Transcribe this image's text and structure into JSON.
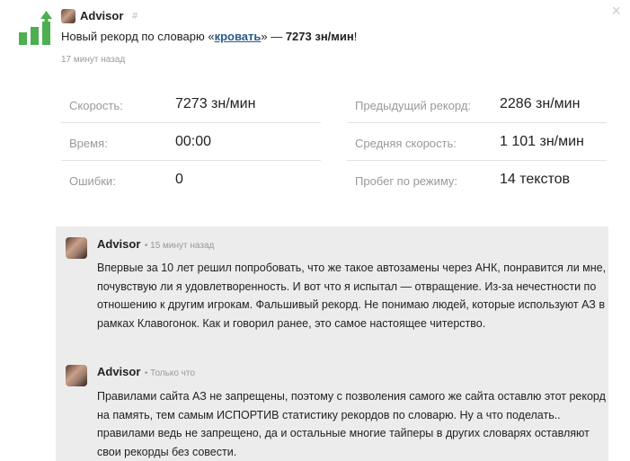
{
  "header": {
    "author": "Advisor",
    "hash": "#",
    "headline_prefix": "Новый рекорд по словарю «",
    "dictionary_link": "кровать",
    "headline_middle": "» — ",
    "headline_speed": "7273 зн/мин",
    "headline_suffix": "!",
    "time_ago": "17 минут назад",
    "close_symbol": "×"
  },
  "stats": {
    "left": [
      {
        "label": "Скорость:",
        "value": "7273 зн/мин"
      },
      {
        "label": "Время:",
        "value": "00:00"
      },
      {
        "label": "Ошибки:",
        "value": "0"
      }
    ],
    "right": [
      {
        "label": "Предыдущий рекорд:",
        "value": "2286 зн/мин"
      },
      {
        "label": "Средняя скорость:",
        "value": "1 101 зн/мин"
      },
      {
        "label": "Пробег по режиму:",
        "value": "14 текстов"
      }
    ]
  },
  "comments": [
    {
      "author": "Advisor",
      "time": "15 минут назад",
      "text": "Впервые за 10 лет решил попробовать, что же такое автозамены через АНК, понравится ли мне, почувствую ли я удовлетворенность. И вот что я испытал — отвращение. Из-за нечестности по отношению к другим игрокам. Фальшивый рекорд. Не понимаю людей, которые используют АЗ в рамках Клавогонок. Как и говорил ранее, это самое настоящее читерство."
    },
    {
      "author": "Advisor",
      "time": "Только что",
      "text": "Правилами сайта АЗ не запрещены, поэтому с позволения самого же сайта оставлю этот рекорд на память, тем самым ИСПОРТИВ статистику рекордов по словарю. Ну а что поделать.. правилами ведь не запрещено, да и остальные многие тайперы в других словарях оставляют свои рекорды без совести."
    }
  ],
  "colors": {
    "logo_green": "#4caf50",
    "link": "#2a5a8a",
    "comments_bg": "#ececec"
  },
  "icons": {
    "logo": "bar-chart-up-arrow-icon",
    "close": "close-icon",
    "avatar": "avatar"
  }
}
